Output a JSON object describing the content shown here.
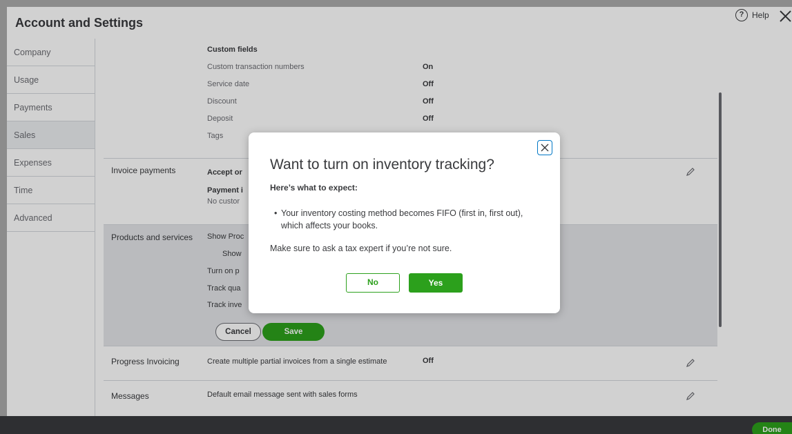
{
  "page": {
    "title": "Account and Settings",
    "help_label": "Help",
    "done_label": "Done"
  },
  "sidebar": {
    "items": [
      {
        "label": "Company"
      },
      {
        "label": "Usage"
      },
      {
        "label": "Payments"
      },
      {
        "label": "Sales"
      },
      {
        "label": "Expenses"
      },
      {
        "label": "Time"
      },
      {
        "label": "Advanced"
      }
    ],
    "active": "Sales"
  },
  "custom_fields": {
    "heading": "Custom fields",
    "rows": [
      {
        "label": "Custom transaction numbers",
        "value": "On"
      },
      {
        "label": "Service date",
        "value": "Off"
      },
      {
        "label": "Discount",
        "value": "Off"
      },
      {
        "label": "Deposit",
        "value": "Off"
      },
      {
        "label": "Tags",
        "value": ""
      }
    ]
  },
  "invoice_payments": {
    "label": "Invoice payments",
    "line1": "Accept or",
    "line2": "Payment i",
    "line3": "No custor"
  },
  "products": {
    "label": "Products and services",
    "line1": "Show Proc",
    "line2": "Show",
    "line3": "Turn on p",
    "line4": "Track qua",
    "line5": "Track inve",
    "cancel_label": "Cancel",
    "save_label": "Save"
  },
  "progress_invoicing": {
    "label": "Progress Invoicing",
    "description": "Create multiple partial invoices from a single estimate",
    "value": "Off"
  },
  "messages": {
    "label": "Messages",
    "description": "Default email message sent with sales forms"
  },
  "dialog": {
    "title": "Want to turn on inventory tracking?",
    "subtitle": "Here’s what to expect:",
    "bullet_line1": "Your inventory costing method becomes FIFO (first in, first out),",
    "bullet_line2": "which affects your books.",
    "note": "Make sure to ask a tax expert if you’re not sure.",
    "no_label": "No",
    "yes_label": "Yes"
  },
  "colors": {
    "accent_green": "#2ca01c",
    "link_blue": "#0077c5",
    "text_dark": "#393a3d"
  },
  "icons": [
    "help-circle-icon",
    "close-icon",
    "pencil-icon",
    "dialog-close-icon"
  ]
}
